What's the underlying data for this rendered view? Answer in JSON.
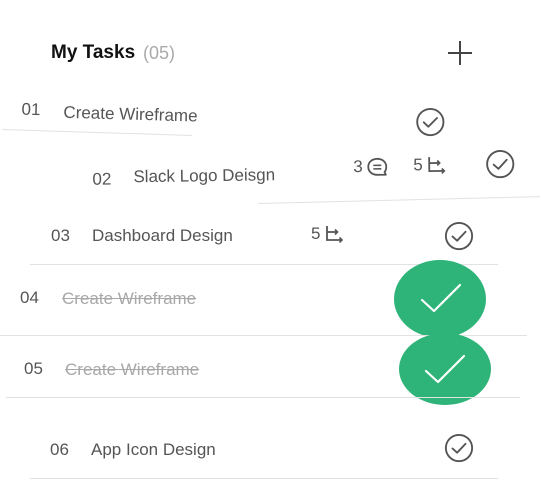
{
  "header": {
    "title": "My Tasks",
    "count": "(05)"
  },
  "tasks": [
    {
      "num": "01",
      "title": "Create Wireframe"
    },
    {
      "num": "02",
      "title": "Slack Logo Deisgn",
      "comments": "3",
      "subtasks": "5"
    },
    {
      "num": "03",
      "title": "Dashboard Design",
      "subtasks": "5"
    },
    {
      "num": "04",
      "title": "Create Wireframe"
    },
    {
      "num": "05",
      "title": "Create Wireframe"
    },
    {
      "num": "06",
      "title": "App Icon Design"
    }
  ],
  "colors": {
    "accent": "#2eb479",
    "text": "#555555",
    "done_text": "#a8a8a8",
    "divider": "#e2e2e2"
  },
  "icons": [
    "plus-icon",
    "check-circle-icon",
    "comment-icon",
    "subtask-icon",
    "check-filled-icon"
  ]
}
